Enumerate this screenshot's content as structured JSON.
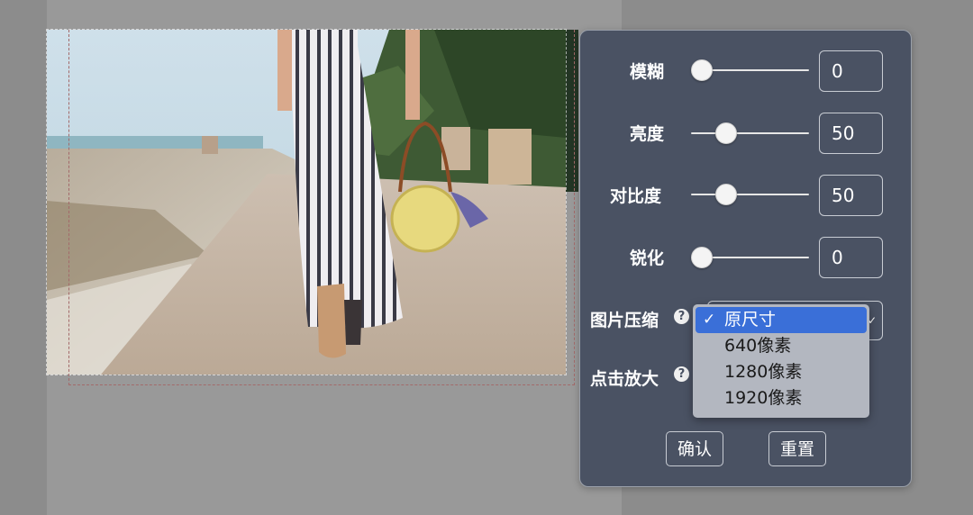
{
  "controls": {
    "blur": {
      "label": "模糊",
      "value": "0",
      "level": 0
    },
    "brightness": {
      "label": "亮度",
      "value": "50",
      "level": 0.5
    },
    "contrast": {
      "label": "对比度",
      "value": "50",
      "level": 0.5
    },
    "sharpen": {
      "label": "锐化",
      "value": "0",
      "level": 0
    }
  },
  "compression": {
    "label": "图片压缩",
    "help_icon": "question-circle-icon",
    "selected": "原尺寸",
    "options": [
      "原尺寸",
      "640像素",
      "1280像素",
      "1920像素"
    ]
  },
  "zoom": {
    "label": "点击放大",
    "help_icon": "question-circle-icon"
  },
  "buttons": {
    "confirm": "确认",
    "reset": "重置"
  },
  "colors": {
    "panel_bg": "#4a5263",
    "selected_option": "#3a6fd8",
    "dropdown_bg": "#b3b7c0"
  }
}
